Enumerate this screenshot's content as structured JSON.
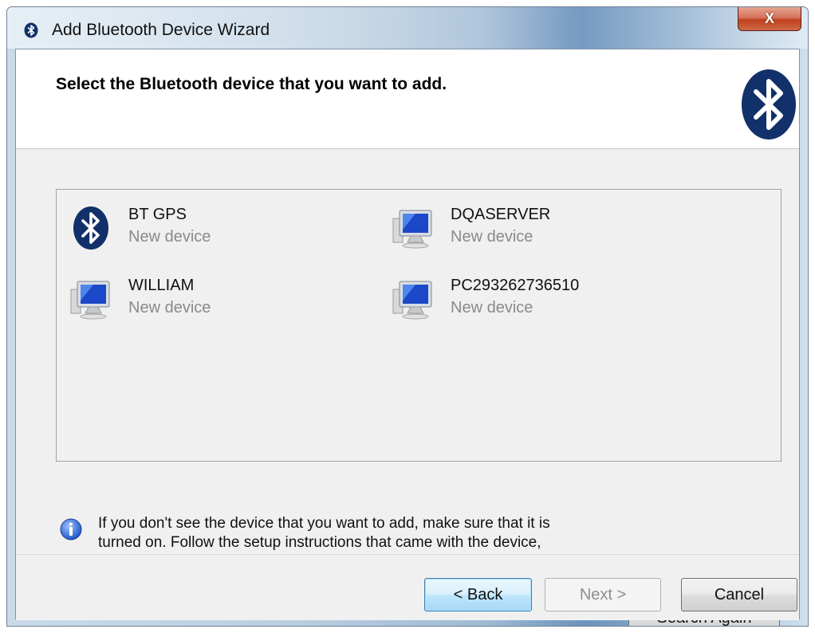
{
  "window": {
    "title": "Add Bluetooth Device Wizard",
    "close_label": "X"
  },
  "header": {
    "title": "Select the Bluetooth device that you want to add."
  },
  "devices": [
    {
      "name": "BT GPS",
      "status": "New device",
      "icon": "bluetooth-icon"
    },
    {
      "name": "DQASERVER",
      "status": "New device",
      "icon": "computer-icon"
    },
    {
      "name": "WILLIAM",
      "status": "New device",
      "icon": "computer-icon"
    },
    {
      "name": "PC293262736510",
      "status": "New device",
      "icon": "computer-icon"
    }
  ],
  "info": {
    "icon": "info-icon",
    "text": "If you don't see the device that you want to add, make sure that it is\nturned on. Follow the setup instructions that came with the device,\nand then click Search Again."
  },
  "buttons": {
    "search_again": "Search Again",
    "back": "< Back",
    "next": "Next >",
    "cancel": "Cancel"
  },
  "colors": {
    "bluetooth_blue": "#12306a",
    "close_red": "#c8452a",
    "default_button_border": "#3c7fb1"
  }
}
